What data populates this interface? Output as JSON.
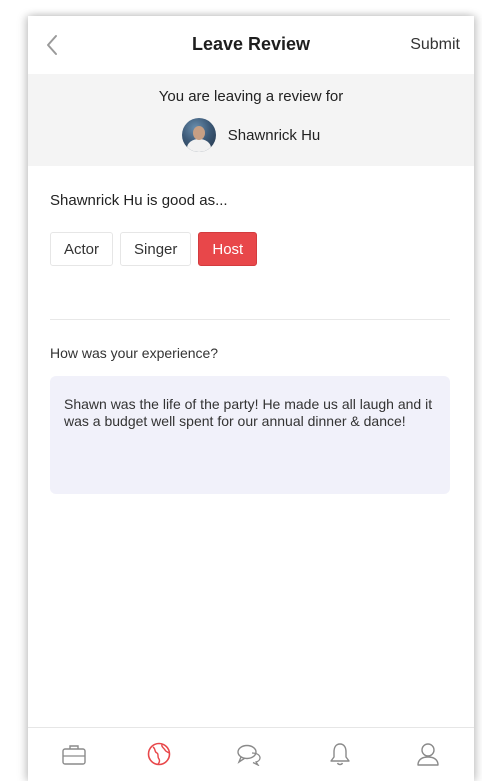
{
  "header": {
    "title": "Leave Review",
    "back_icon": "chevron-left-icon",
    "submit_label": "Submit"
  },
  "review_for": {
    "intro": "You are leaving a review for",
    "name": "Shawnrick Hu"
  },
  "roles": {
    "prompt": "Shawnrick Hu is good as...",
    "options": [
      {
        "label": "Actor",
        "selected": false
      },
      {
        "label": "Singer",
        "selected": false
      },
      {
        "label": "Host",
        "selected": true
      }
    ]
  },
  "experience": {
    "prompt": "How was your experience?",
    "value": "Shawn was the life of the party! He made us all laugh and it was a budget well spent for our annual dinner & dance!"
  },
  "tabbar": {
    "items": [
      {
        "icon": "briefcase-icon",
        "active": false
      },
      {
        "icon": "globe-icon",
        "active": true
      },
      {
        "icon": "chat-bubbles-icon",
        "active": false
      },
      {
        "icon": "bell-icon",
        "active": false
      },
      {
        "icon": "profile-icon",
        "active": false
      }
    ]
  },
  "colors": {
    "accent": "#e8474a",
    "section_bg": "#f4f4f4",
    "input_bg": "#f1f1fa",
    "icon_gray": "#8a8a8a"
  }
}
